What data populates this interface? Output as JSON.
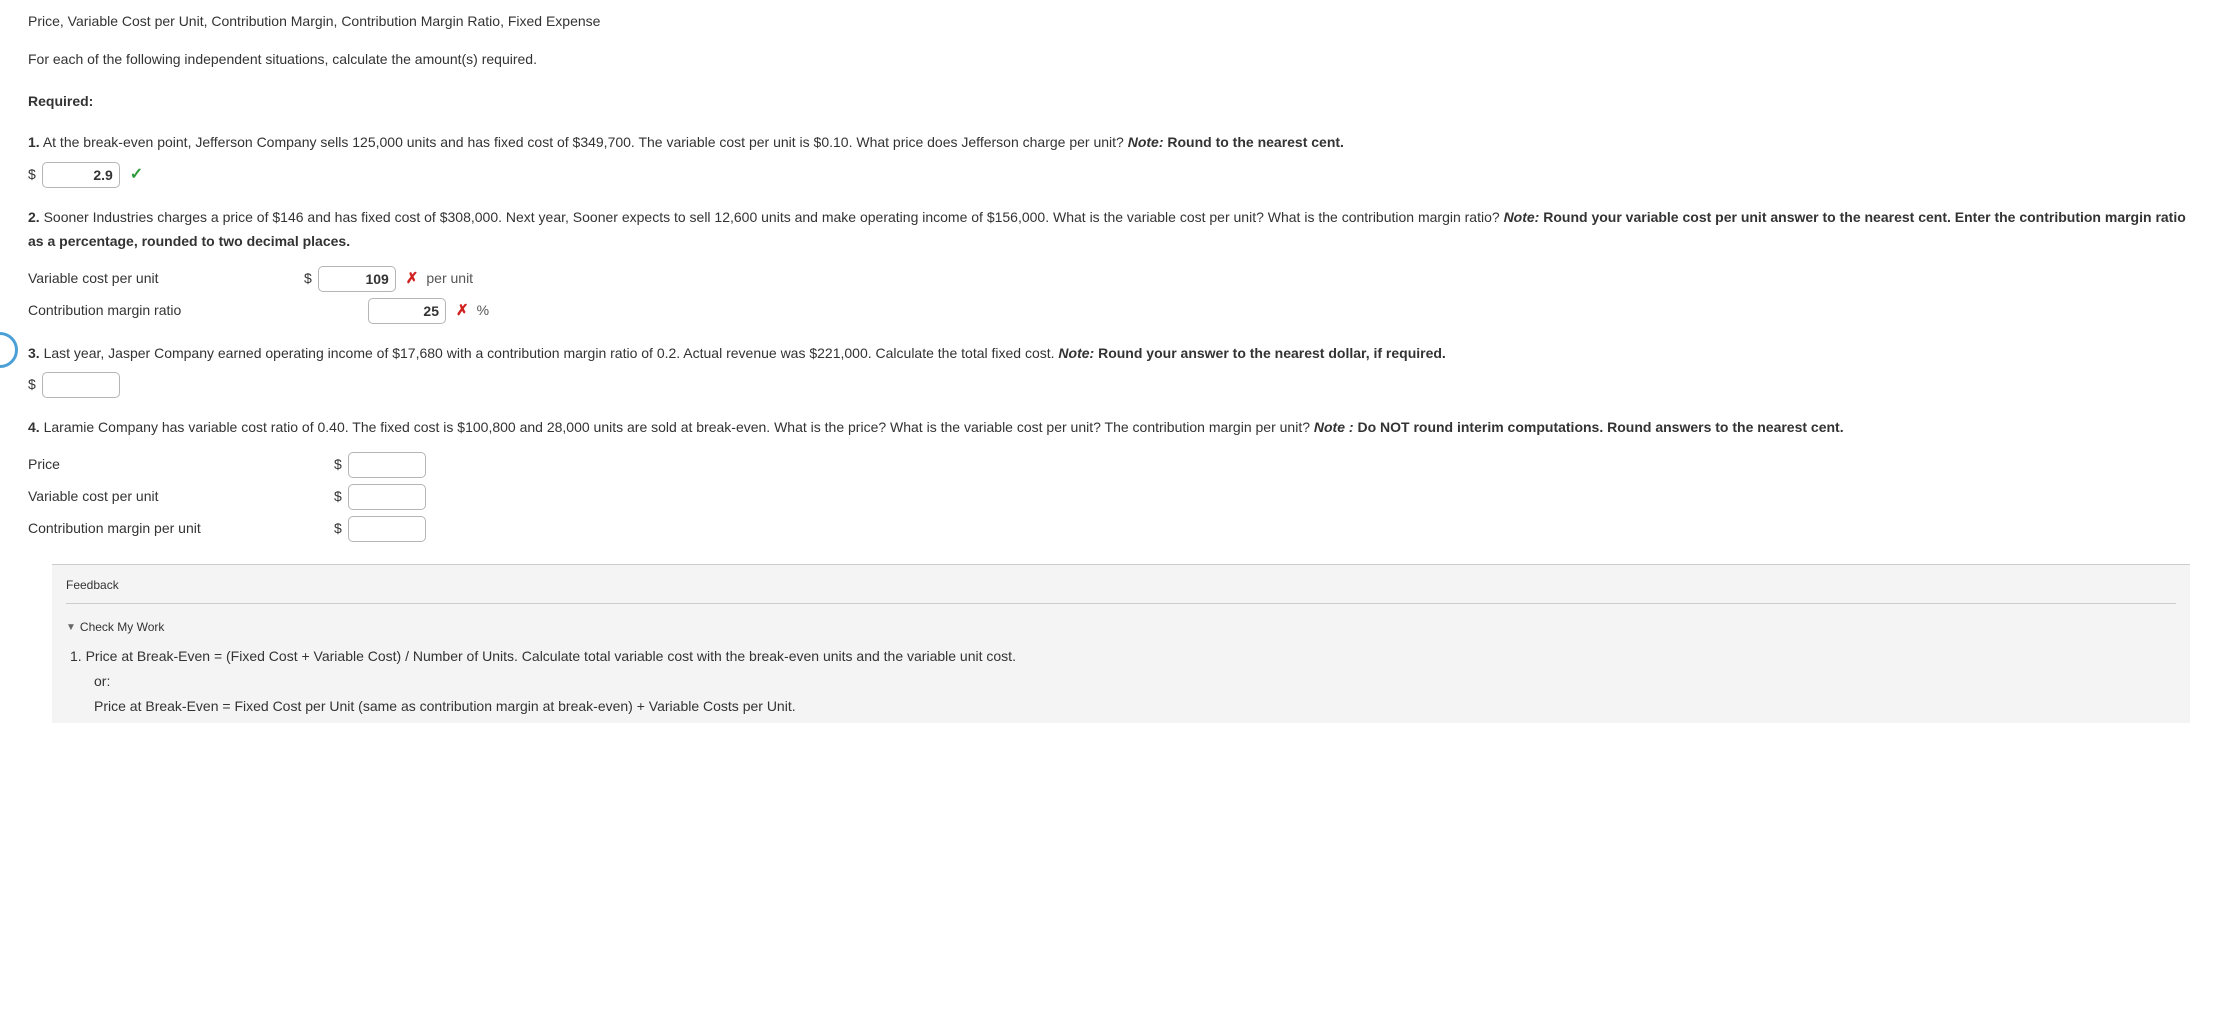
{
  "header": {
    "title_line": "Price, Variable Cost per Unit, Contribution Margin, Contribution Margin Ratio, Fixed Expense",
    "intro": "For each of the following independent situations, calculate the amount(s) required.",
    "required_label": "Required:"
  },
  "q1": {
    "num": "1.",
    "text": "At the break-even point, Jefferson Company sells 125,000 units and has fixed cost of $349,700. The variable cost per unit is $0.10. What price does Jefferson charge per unit? ",
    "note_label": "Note:",
    "note_text": " Round to the nearest cent.",
    "currency": "$",
    "value": "2.9"
  },
  "q2": {
    "num": "2.",
    "text": "Sooner Industries charges a price of $146 and has fixed cost of $308,000. Next year, Sooner expects to sell 12,600 units and make operating income of $156,000. What is the variable cost per unit? What is the contribution margin ratio? ",
    "note_label": "Note:",
    "note_text": " Round your variable cost per unit answer to the nearest cent. Enter the contribution margin ratio as a percentage, rounded to two decimal places.",
    "row1_label": "Variable cost per unit",
    "row1_currency": "$",
    "row1_value": "109",
    "row1_suffix": "per unit",
    "row2_label": "Contribution margin ratio",
    "row2_value": "25",
    "row2_suffix": "%"
  },
  "q3": {
    "num": "3.",
    "text": "Last year, Jasper Company earned operating income of $17,680 with a contribution margin ratio of 0.2. Actual revenue was $221,000. Calculate the total fixed cost. ",
    "note_label": "Note:",
    "note_text": " Round your answer to the nearest dollar, if required.",
    "currency": "$",
    "value": ""
  },
  "q4": {
    "num": "4.",
    "text": "Laramie Company has variable cost ratio of 0.40. The fixed cost is $100,800 and 28,000 units are sold at break-even. What is the price? What is the variable cost per unit? The contribution margin per unit? ",
    "note_label": "Note :",
    "note_text": " Do NOT round interim computations. Round answers to the nearest cent.",
    "row1_label": "Price",
    "row1_currency": "$",
    "row1_value": "",
    "row2_label": "Variable cost per unit",
    "row2_currency": "$",
    "row2_value": "",
    "row3_label": "Contribution margin per unit",
    "row3_currency": "$",
    "row3_value": ""
  },
  "feedback": {
    "title": "Feedback",
    "toggle": "Check My Work",
    "line1": "1. Price at Break-Even = (Fixed Cost + Variable Cost) / Number of Units. Calculate total variable cost with the break-even units and the variable unit cost.",
    "line_or": "or:",
    "line2": "Price at Break-Even = Fixed Cost per Unit (same as contribution margin at break-even) + Variable Costs per Unit."
  }
}
